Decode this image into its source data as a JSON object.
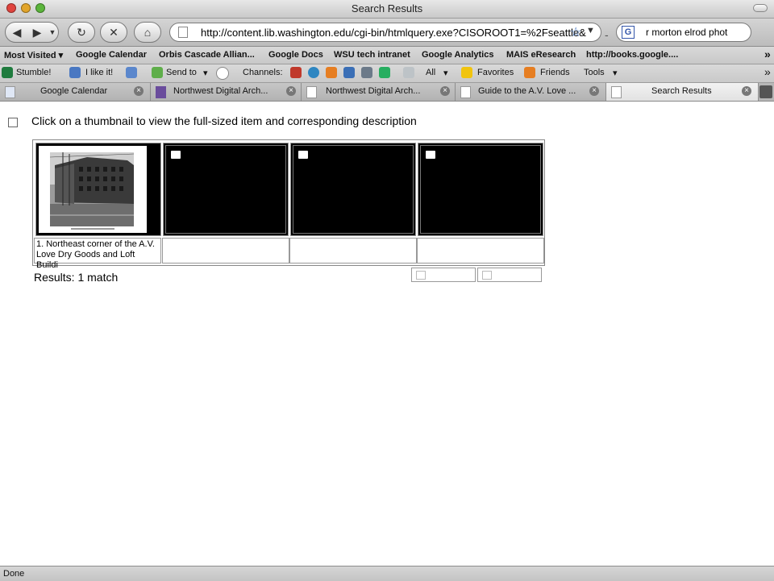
{
  "window": {
    "title": "Search Results"
  },
  "nav": {
    "back": "◀",
    "forward": "▶",
    "history": "▼",
    "reload": "↻",
    "stop": "✕",
    "home": "⌂",
    "url": "http://content.lib.washington.edu/cgi-bin/htmlquery.exe?CISOROOT1=%2Fseattle&",
    "star": "☆",
    "url_dropdown": "▼",
    "dash": "-",
    "search_engine": "G",
    "search_value": "r morton elrod phot"
  },
  "bookmarks": [
    "Most Visited ▾",
    "Google Calendar",
    "Orbis Cascade Allian...",
    "Google Docs",
    "WSU tech intranet",
    "Google Analytics",
    "MAIS eResearch",
    "http://books.google...."
  ],
  "bookmarks_more": "»",
  "stumble": {
    "stumble": "Stumble!",
    "like": "I like it!",
    "send_to": "Send to",
    "send_arrow": "▾",
    "channels": "Channels:",
    "all": "All",
    "all_arrow": "▾",
    "favorites": "Favorites",
    "friends": "Friends",
    "tools": "Tools",
    "tools_arrow": "▾",
    "more": "»"
  },
  "tabs": [
    {
      "label": "Google Calendar",
      "active": false
    },
    {
      "label": "Northwest Digital Arch...",
      "active": false
    },
    {
      "label": "Northwest Digital Arch...",
      "active": false
    },
    {
      "label": "Guide to the A.V. Love ...",
      "active": false
    },
    {
      "label": "Search Results",
      "active": true
    }
  ],
  "content": {
    "instruction": "Click on a thumbnail to view the full-sized item and corresponding description",
    "results_text": "Results: 1 match",
    "items": [
      {
        "caption": "1. Northeast corner of the A.V. Love Dry Goods and Loft Buildi"
      },
      {
        "caption": ""
      },
      {
        "caption": ""
      },
      {
        "caption": ""
      }
    ]
  },
  "status": {
    "text": "Done"
  }
}
